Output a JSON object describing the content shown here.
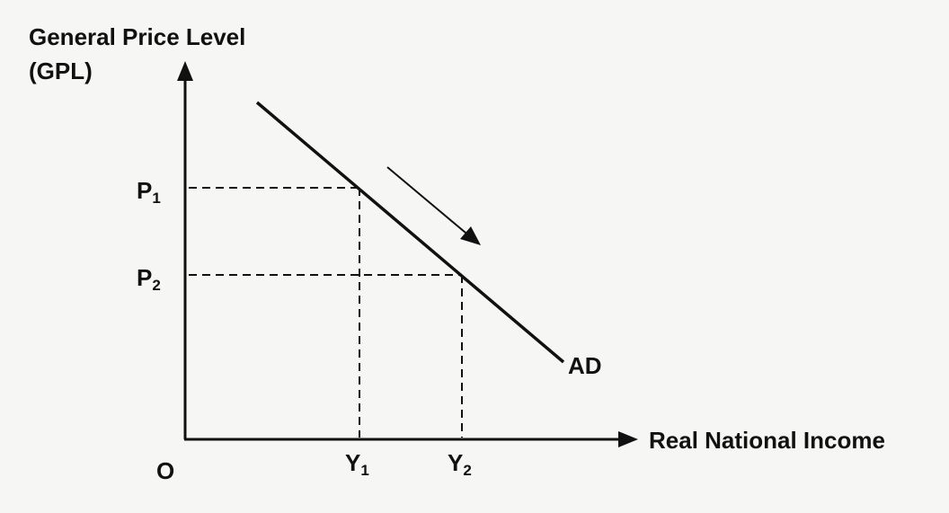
{
  "diagram": {
    "y_axis_label_line1": "General Price Level",
    "y_axis_label_line2": "(GPL)",
    "x_axis_label": "Real National Income",
    "origin_label": "O",
    "curve_label": "AD",
    "price_levels": [
      {
        "letter": "P",
        "subscript": "1"
      },
      {
        "letter": "P",
        "subscript": "2"
      }
    ],
    "income_levels": [
      {
        "letter": "Y",
        "subscript": "1"
      },
      {
        "letter": "Y",
        "subscript": "2"
      }
    ],
    "movement": "downward along AD curve"
  }
}
